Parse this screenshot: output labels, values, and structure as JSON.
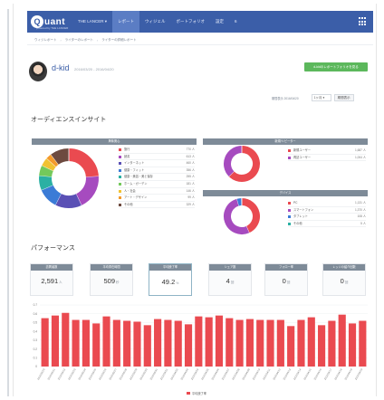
{
  "nav": {
    "logo_mark": "Q",
    "logo_text": "uant",
    "logo_sub": "powered by THE LANCER",
    "items": [
      {
        "label": "THE LANCER ▾",
        "active": false
      },
      {
        "label": "レポート",
        "active": true
      },
      {
        "label": "ウィジェル",
        "active": false
      },
      {
        "label": "ポートフォリオ",
        "active": false
      },
      {
        "label": "設定",
        "active": false
      },
      {
        "label": "6",
        "active": false
      }
    ]
  },
  "breadcrumb": [
    "ウィジレポート",
    "ライターのレポート",
    "ライターの詳細レポート"
  ],
  "user": {
    "name": "d-kid",
    "date_range": "2016/03/20 - 2016/04/20",
    "portfolio_button": "d-kidのレポートフォリオを見る"
  },
  "filter": {
    "label": "期間表示 2016/04/20",
    "select_value": "1ヶ月",
    "button": "期間表示"
  },
  "audience": {
    "title": "オーディエンスインサイト",
    "interest": {
      "header": "興味関心",
      "items": [
        {
          "name": "旅行",
          "value": "770 人",
          "color": "#ea4a50"
        },
        {
          "name": "読書",
          "value": "613 人",
          "color": "#a64bbf"
        },
        {
          "name": "インターネット",
          "value": "460 人",
          "color": "#5a50b5"
        },
        {
          "name": "健康・フィット",
          "value": "356 人",
          "color": "#3b7bd6"
        },
        {
          "name": "健康・美容・美と保存",
          "value": "255 人",
          "color": "#2bb0a3"
        },
        {
          "name": "ホーム・ガーデン",
          "value": "181 人",
          "color": "#74c95b"
        },
        {
          "name": "人・社会",
          "value": "146 人",
          "color": "#f1c232"
        },
        {
          "name": "アート・デザイン",
          "value": "99 人",
          "color": "#f39a2b"
        },
        {
          "name": "その他",
          "value": "329 人",
          "color": "#6d4a3f"
        }
      ]
    },
    "visitor": {
      "header": "新規/リピーター",
      "items": [
        {
          "name": "新規ユーザー",
          "value": "1,687 人",
          "color": "#ea4a50"
        },
        {
          "name": "再訪ユーザー",
          "value": "1,004 人",
          "color": "#a64bbf"
        }
      ]
    },
    "device": {
      "header": "デバイス",
      "items": [
        {
          "name": "PC",
          "value": "1,131 人",
          "color": "#ea4a50"
        },
        {
          "name": "スマートフォン",
          "value": "1,370 人",
          "color": "#a64bbf"
        },
        {
          "name": "タブレット",
          "value": "108 人",
          "color": "#3b7bd6"
        },
        {
          "name": "その他",
          "value": "5 人",
          "color": "#2bb0a3"
        }
      ]
    }
  },
  "performance": {
    "title": "パフォーマンス",
    "metrics": [
      {
        "label": "訪問者数",
        "value": "2,591",
        "unit": "人",
        "selected": false
      },
      {
        "label": "平均滞在時間",
        "value": "509",
        "unit": "秒",
        "selected": false
      },
      {
        "label": "平均読了率",
        "value": "49.2",
        "unit": "%",
        "selected": true
      },
      {
        "label": "シェア数",
        "value": "4",
        "unit": "回",
        "selected": false
      },
      {
        "label": "フォロー率",
        "value": "0",
        "unit": "回",
        "selected": false
      },
      {
        "label": "レッジの紹介回数",
        "value": "0",
        "unit": "回",
        "selected": false
      }
    ]
  },
  "chart_data": {
    "type": "bar",
    "categories": [
      "2016/03/20",
      "2016/03/21",
      "2016/03/22",
      "2016/03/23",
      "2016/03/24",
      "2016/03/25",
      "2016/03/26",
      "2016/03/27",
      "2016/03/28",
      "2016/03/29",
      "2016/03/30",
      "2016/03/31",
      "2016/04/01",
      "2016/04/02",
      "2016/04/03",
      "2016/04/04",
      "2016/04/05",
      "2016/04/06",
      "2016/04/07",
      "2016/04/08",
      "2016/04/09",
      "2016/04/10",
      "2016/04/11",
      "2016/04/12",
      "2016/04/13",
      "2016/04/14",
      "2016/04/15",
      "2016/04/16",
      "2016/04/17",
      "2016/04/18",
      "2016/04/19",
      "2016/04/20"
    ],
    "series": [
      {
        "name": "平均読了率",
        "color": "#ea4a50",
        "values": [
          0.55,
          0.58,
          0.61,
          0.53,
          0.53,
          0.49,
          0.57,
          0.53,
          0.52,
          0.51,
          0.47,
          0.54,
          0.53,
          0.52,
          0.48,
          0.57,
          0.56,
          0.58,
          0.55,
          0.53,
          0.54,
          0.53,
          0.53,
          0.53,
          0.46,
          0.53,
          0.56,
          0.47,
          0.52,
          0.59,
          0.49,
          0.52
        ]
      }
    ],
    "ylim": [
      0,
      0.7
    ],
    "yticks": [
      "0.7",
      "0.6",
      "0.5",
      "0.4",
      "0.3",
      "0.2",
      "0.1",
      "0"
    ],
    "grid": true,
    "legend": "bottom",
    "legend_label": "平均読了率"
  }
}
